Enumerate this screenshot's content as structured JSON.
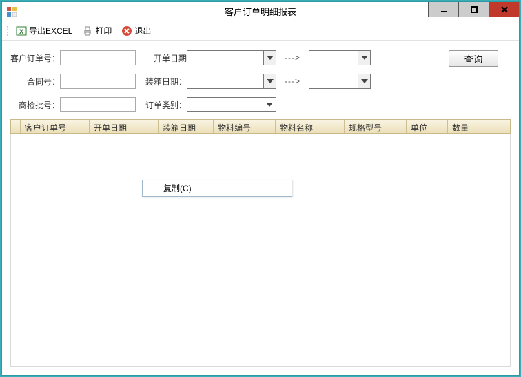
{
  "window": {
    "title": "客户订单明细报表"
  },
  "toolbar": {
    "export": "导出EXCEL",
    "print": "打印",
    "exit": "退出"
  },
  "form": {
    "order_no_label": "客户订单号：",
    "order_no_value": "",
    "open_date_label": "开单日期",
    "open_date_from": "",
    "open_date_to": "",
    "contract_label": "合同号：",
    "contract_value": "",
    "pack_date_label": "装箱日期：",
    "pack_date_from": "",
    "pack_date_to": "",
    "inspect_label": "商检批号：",
    "inspect_value": "",
    "type_label": "订单类别：",
    "type_value": "",
    "range_sep": "--->",
    "query_btn": "查询"
  },
  "grid": {
    "columns": [
      "客户订单号",
      "开单日期",
      "装箱日期",
      "物料编号",
      "物料名称",
      "规格型号",
      "单位",
      "数量"
    ]
  },
  "context_menu": {
    "copy": "复制(C)"
  }
}
